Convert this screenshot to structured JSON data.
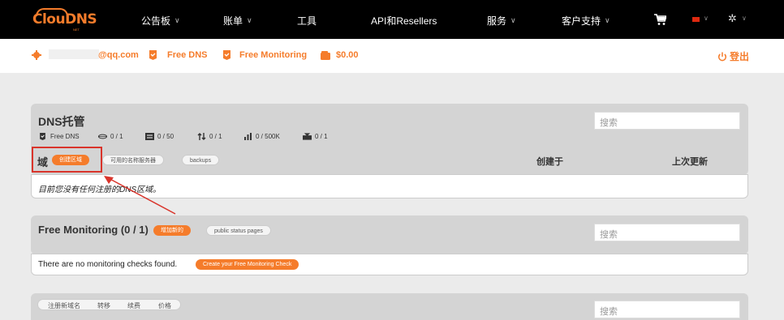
{
  "brand": {
    "name": "ClouDNS",
    "sub": "NET"
  },
  "nav": {
    "items": [
      {
        "label": "公告板",
        "caret": "∨"
      },
      {
        "label": "账单",
        "caret": "∨"
      },
      {
        "label": "工具",
        "caret": ""
      },
      {
        "label": "API和Resellers",
        "caret": ""
      },
      {
        "label": "服务",
        "caret": "∨"
      },
      {
        "label": "客户支持",
        "caret": "∨"
      }
    ],
    "cart_icon": "cart-icon",
    "flag": "china-flag-icon",
    "settings_icon": "gear-icon",
    "caret": "∨"
  },
  "account": {
    "email": "@qq.com",
    "plans": [
      "Free DNS",
      "Free Monitoring"
    ],
    "balance": "$0.00",
    "logout": "登出"
  },
  "dns_hosting": {
    "title": "DNS托管",
    "plan": "Free DNS",
    "stats": [
      "0 / 1",
      "0 / 50",
      "0 / 1",
      "0 / 500K",
      "0 / 1"
    ],
    "domain_label": "域",
    "create_zone": "创建区域",
    "available_ns": "可用的名称服务器",
    "backups": "backups",
    "col_created": "创建于",
    "col_updated": "上次更新",
    "empty": "目前您没有任何注册的DNS区域。",
    "search_placeholder": "搜索"
  },
  "monitoring": {
    "title": "Free Monitoring (0 / 1)",
    "add_new": "增加新的",
    "status_pages": "public status pages",
    "empty": "There are no monitoring checks found.",
    "create_check": "Create your Free Monitoring Check",
    "search_placeholder": "搜索"
  },
  "domains": {
    "tabs": [
      "注册新域名",
      "转移",
      "续费",
      "价格"
    ],
    "search_placeholder": "搜索"
  },
  "colors": {
    "accent": "#f57c2b",
    "highlight": "#d9342b",
    "nav_bg": "#000000"
  }
}
